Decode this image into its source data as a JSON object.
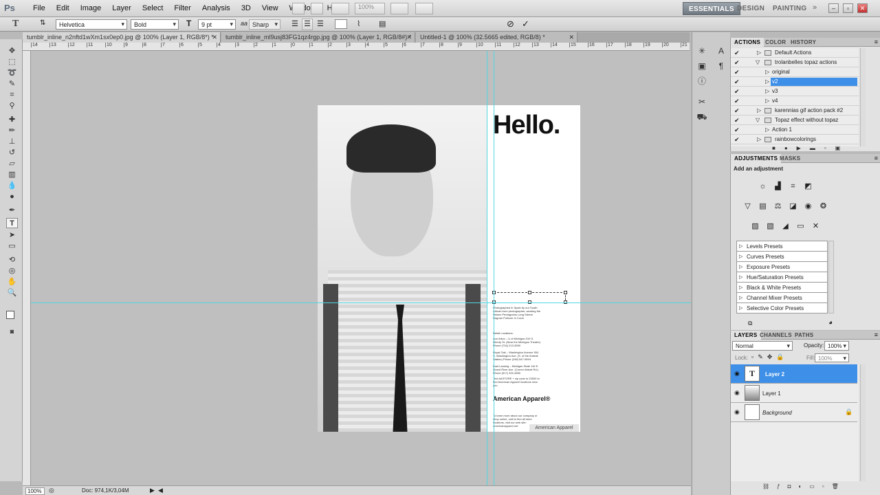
{
  "app": {
    "logo": "Ps"
  },
  "menu": [
    "File",
    "Edit",
    "Image",
    "Layer",
    "Select",
    "Filter",
    "Analysis",
    "3D",
    "View",
    "Window",
    "Help"
  ],
  "zoom_menu": "100%",
  "workspaces": [
    "ESSENTIALS",
    "DESIGN",
    "PAINTING"
  ],
  "options": {
    "font_family": "Helvetica",
    "font_style": "Bold",
    "font_size": "9 pt",
    "antialias_label": "aa",
    "antialias": "Sharp",
    "text_icon": "T"
  },
  "tabs": [
    {
      "label": "tumblr_inline_n2nftd1wXm1sx0ep0.jpg @ 100% (Layer 1, RGB/8*) *",
      "active": true
    },
    {
      "label": "tumblr_inline_ml9usj83FG1qz4rgp.jpg @ 100% (Layer 1, RGB/8#) *",
      "active": false
    },
    {
      "label": "Untitled-1 @ 100% (32.5665 edited, RGB/8) *",
      "active": false
    }
  ],
  "ruler_labels": [
    "14",
    "13",
    "12",
    "11",
    "10",
    "9",
    "8",
    "7",
    "6",
    "5",
    "4",
    "3",
    "2",
    "1",
    "0",
    "1",
    "2",
    "3",
    "4",
    "5",
    "6",
    "7",
    "8",
    "9",
    "10",
    "11",
    "12",
    "13",
    "14",
    "15",
    "16",
    "17",
    "18",
    "19",
    "20",
    "21"
  ],
  "document": {
    "headline": "Hello.",
    "body_text": "Photographed in Spain by our South African born photographer, wearing the Unisex Pentagrams Long Sleeve Ragnan Pullover in Coral.",
    "retail_heading": "Retail Locations:",
    "address1": "Ann Arbor – U of Michigan 319 S. Liberty St. (Near the Michigan Theatre) Phone (734) 213-3590",
    "address2": "Royal Oak – Washington Avenue 504 S. Washington Ave. (S. of the Amtrak Station) Phone (248) 547-0694",
    "address3": "East Lansing – Michigan State 115 E. Grand River Ave. (Corner Abbott Rd.) Phone (517) 332-4850",
    "sms": "Text AASTORE + zip code to 23000 to find American Apparel locations near you.",
    "brand": "American Apparel®",
    "learn": "To learn more about our company or shop online, visit to find all store locations, visit our web site: americanapparel.net",
    "caption": "American Apparel"
  },
  "status": {
    "zoom": "100%",
    "doc": "Doc: 974,1K/3,04M"
  },
  "actions": {
    "tabs": [
      "ACTIONS",
      "COLOR",
      "HISTORY"
    ],
    "rows": [
      {
        "label": "Default Actions",
        "level": 0,
        "type": "set",
        "open": false,
        "selected": false
      },
      {
        "label": "trolanbelles topaz actions",
        "level": 0,
        "type": "set",
        "open": true,
        "selected": false
      },
      {
        "label": "original",
        "level": 1,
        "type": "action",
        "open": false,
        "selected": false
      },
      {
        "label": "v2",
        "level": 1,
        "type": "action",
        "open": false,
        "selected": true
      },
      {
        "label": "v3",
        "level": 1,
        "type": "action",
        "open": false,
        "selected": false
      },
      {
        "label": "v4",
        "level": 1,
        "type": "action",
        "open": false,
        "selected": false
      },
      {
        "label": "karennias gif action pack #2",
        "level": 0,
        "type": "set",
        "open": false,
        "selected": false
      },
      {
        "label": "Topaz effect without topaz",
        "level": 0,
        "type": "set",
        "open": true,
        "selected": false
      },
      {
        "label": "Action 1",
        "level": 1,
        "type": "action",
        "open": false,
        "selected": false
      },
      {
        "label": "rainbowcolorings",
        "level": 0,
        "type": "set",
        "open": false,
        "selected": false
      }
    ]
  },
  "adjustments": {
    "tabs": [
      "ADJUSTMENTS",
      "MASKS"
    ],
    "title": "Add an adjustment",
    "presets": [
      "Levels Presets",
      "Curves Presets",
      "Exposure Presets",
      "Hue/Saturation Presets",
      "Black & White Presets",
      "Channel Mixer Presets",
      "Selective Color Presets"
    ]
  },
  "layers": {
    "tabs": [
      "LAYERS",
      "CHANNELS",
      "PATHS"
    ],
    "blend": "Normal",
    "opacity_label": "Opacity:",
    "opacity": "100%",
    "lock_label": "Lock:",
    "fill_label": "Fill:",
    "fill": "100%",
    "items": [
      {
        "name": "Layer 2",
        "kind": "text",
        "selected": true,
        "locked": false
      },
      {
        "name": "Layer 1",
        "kind": "photo",
        "selected": false,
        "locked": false
      },
      {
        "name": "Background",
        "kind": "background",
        "selected": false,
        "locked": true
      }
    ]
  },
  "colors": {
    "accent": "#3d8fe8",
    "selected_layer": "#3d8fe8",
    "guide": "#4fd6e0"
  }
}
